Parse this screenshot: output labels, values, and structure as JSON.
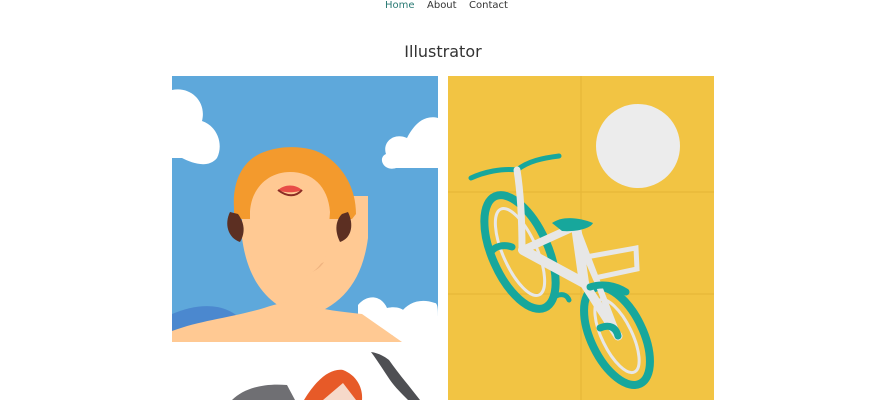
{
  "nav": {
    "items": [
      {
        "label": "Home",
        "active": true
      },
      {
        "label": "About",
        "active": false
      },
      {
        "label": "Contact",
        "active": false
      }
    ],
    "active_color": "#2a7a74"
  },
  "page": {
    "title": "Illustrator"
  },
  "gallery": {
    "items": [
      {
        "subject": "portrait-looking-up",
        "background": "#5ea8db"
      },
      {
        "subject": "bicycle-and-sun",
        "background": "#f2c443"
      },
      {
        "subject": "partial-illustration",
        "background": "#ffffff"
      }
    ]
  }
}
